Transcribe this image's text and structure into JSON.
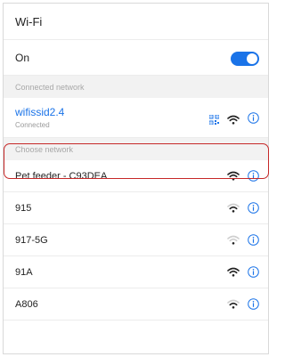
{
  "header": {
    "title": "Wi-Fi"
  },
  "toggle": {
    "label": "On",
    "state": "on",
    "accent": "#1a73e8"
  },
  "sections": {
    "connected": "Connected network",
    "choose": "Choose network"
  },
  "connected_network": {
    "name": "wifissid2.4",
    "status": "Connected",
    "icons": [
      "qr-code-icon",
      "wifi-signal-icon",
      "info-icon"
    ]
  },
  "networks": [
    {
      "name": "Pet feeder - C93DEA",
      "signal": "strong",
      "highlighted": true
    },
    {
      "name": "915",
      "signal": "medium"
    },
    {
      "name": "917-5G",
      "signal": "weak"
    },
    {
      "name": "91A",
      "signal": "strong"
    },
    {
      "name": "A806",
      "signal": "medium"
    }
  ],
  "highlight_color": "#c62828"
}
